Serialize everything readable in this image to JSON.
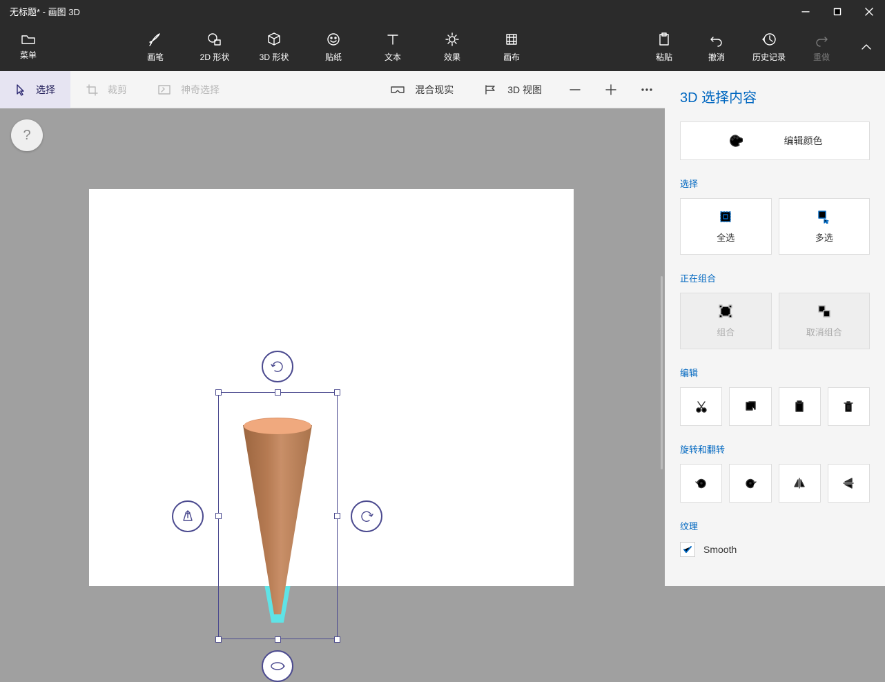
{
  "title": "无标题* - 画图 3D",
  "menu_label": "菜单",
  "tools": {
    "brush": "画笔",
    "shapes2d": "2D 形状",
    "shapes3d": "3D 形状",
    "stickers": "贴纸",
    "text": "文本",
    "effects": "效果",
    "canvas": "画布"
  },
  "rtools": {
    "paste": "粘贴",
    "undo": "撤消",
    "history": "历史记录",
    "redo": "重做"
  },
  "secondbar": {
    "select": "选择",
    "crop": "裁剪",
    "magic": "神奇选择",
    "mixed": "混合现实",
    "view3d": "3D 视图"
  },
  "help": "?",
  "panel": {
    "title": "3D 选择内容",
    "edit_color": "编辑颜色",
    "section_select": "选择",
    "select_all": "全选",
    "multi_select": "多选",
    "section_group": "正在组合",
    "group": "组合",
    "ungroup": "取消组合",
    "section_edit": "编辑",
    "section_rotate": "旋转和翻转",
    "section_texture": "纹理",
    "smooth": "Smooth"
  }
}
